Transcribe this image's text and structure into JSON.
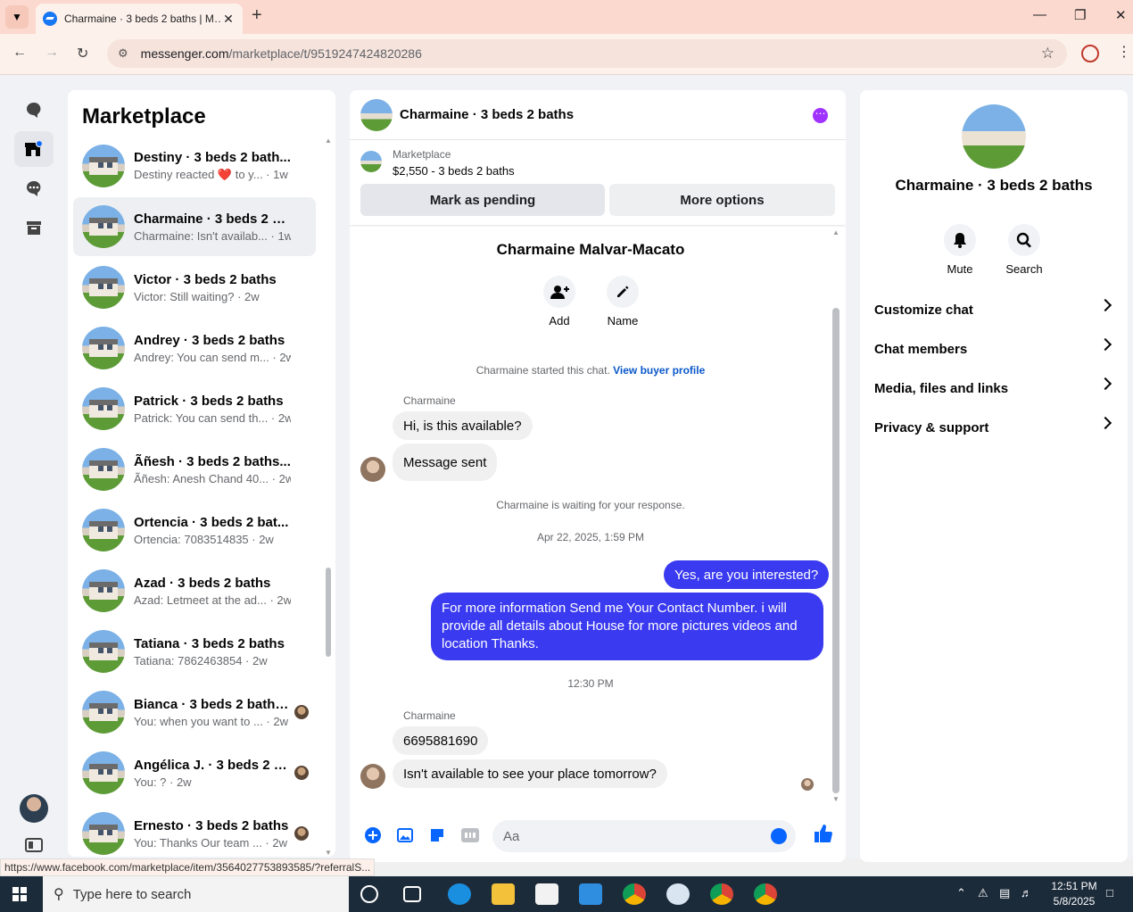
{
  "browser": {
    "tab_title": "Charmaine · 3 beds 2 baths | M…",
    "url_host": "messenger.com",
    "url_path": "/marketplace/t/9519247424820286",
    "status_url": "https://www.facebook.com/marketplace/item/3564027753893585/?referralS..."
  },
  "sidebar": {
    "heading": "Marketplace",
    "conversations": [
      {
        "name": "Destiny · 3 beds 2 bath...",
        "snippet": "Destiny reacted ❤️ to y... · 1w"
      },
      {
        "name": "Charmaine · 3 beds 2 b...",
        "snippet": "Charmaine: Isn't availab... · 1w"
      },
      {
        "name": "Victor · 3 beds 2 baths",
        "snippet": "Victor: Still waiting? · 2w"
      },
      {
        "name": "Andrey · 3 beds 2 baths",
        "snippet": "Andrey: You can send m... · 2w"
      },
      {
        "name": "Patrick · 3 beds 2 baths",
        "snippet": "Patrick: You can send th... · 2w"
      },
      {
        "name": "Ãñesh · 3 beds 2 baths...",
        "snippet": "Ãñesh: Anesh Chand 40... · 2w"
      },
      {
        "name": "Ortencia · 3 beds 2 bat...",
        "snippet": "Ortencia: 7083514835 · 2w"
      },
      {
        "name": "Azad · 3 beds 2 baths",
        "snippet": "Azad: Letmeet at the ad... · 2w"
      },
      {
        "name": "Tatiana · 3 beds 2 baths",
        "snippet": "Tatiana: 7862463854 · 2w"
      },
      {
        "name": "Bianca · 3 beds 2 baths...",
        "snippet": "You: when you want to ... · 2w"
      },
      {
        "name": "Angélica J. · 3 beds 2 b...",
        "snippet": "You: ? · 2w"
      },
      {
        "name": "Ernesto · 3 beds 2 baths",
        "snippet": "You: Thanks Our team ... · 2w"
      }
    ]
  },
  "chat": {
    "title": "Charmaine · 3 beds 2 baths",
    "marketplace_label": "Marketplace",
    "listing": "$2,550 - 3 beds 2 baths",
    "mark_pending": "Mark as pending",
    "more_options": "More options",
    "seller_name": "Charmaine Malvar-Macato",
    "add_label": "Add",
    "name_label": "Name",
    "started_text": "Charmaine started this chat.",
    "view_profile": "View buyer profile",
    "sender": "Charmaine",
    "msg1": "Hi, is this available?",
    "msg2": "Message sent",
    "waiting": "Charmaine is waiting for your response.",
    "time1": "Apr 22, 2025, 1:59 PM",
    "reply1": "Yes, are you interested?",
    "reply2": "For more information  Send me Your Contact Number.  i will provide all details about House for more pictures videos and location Thanks.",
    "time2": "12:30 PM",
    "msg3": "6695881690",
    "msg4": "Isn't available to see your place tomorrow?",
    "composer_placeholder": "Aa"
  },
  "info": {
    "title": "Charmaine · 3 beds 2 baths",
    "mute": "Mute",
    "search": "Search",
    "rows": [
      "Customize chat",
      "Chat members",
      "Media, files and links",
      "Privacy & support"
    ]
  },
  "taskbar": {
    "search_placeholder": "Type here to search",
    "time": "12:51 PM",
    "date": "5/8/2025"
  },
  "colors": {
    "accent": "#0866ff",
    "outgoing": "#3a3af0",
    "tab_bg": "#fbd9cf"
  }
}
